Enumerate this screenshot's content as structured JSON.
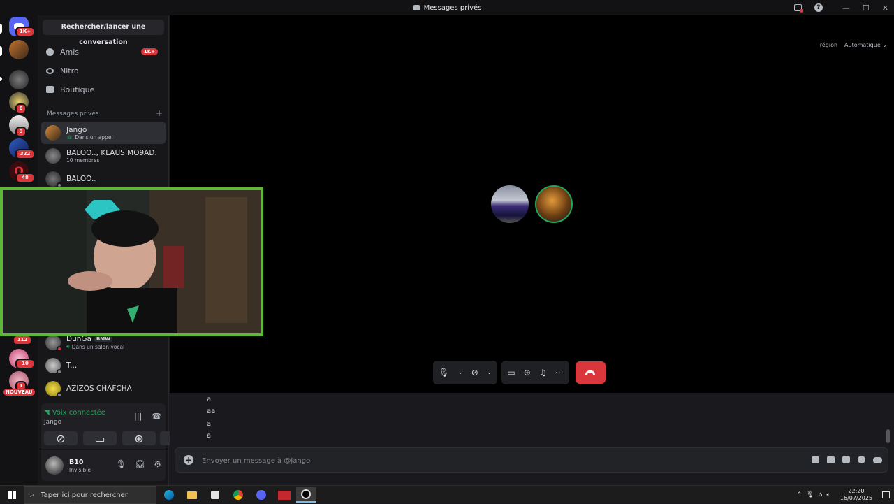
{
  "window": {
    "title": "Messages privés"
  },
  "guilds": {
    "home_badge": "1K+",
    "badges": [
      "6",
      "9",
      "322",
      "48",
      "112",
      "10",
      "1"
    ],
    "new_label": "NOUVEAU"
  },
  "dm_column": {
    "search_label": "Rechercher/lancer une conversation",
    "nav": [
      {
        "label": "Amis",
        "badge": "1K+",
        "icon": "friends-icon"
      },
      {
        "label": "Nitro",
        "icon": "nitro-icon"
      },
      {
        "label": "Boutique",
        "icon": "shop-icon"
      }
    ],
    "section_title": "Messages privés",
    "section_add": "+",
    "dms": [
      {
        "name": "Jango",
        "sub": "Dans un appel"
      },
      {
        "name": "BALOO.., KLAUS MO9AD...",
        "sub": "10 membres"
      },
      {
        "name": "BALOO.."
      },
      {
        "name": "DunGa",
        "tag": "BMW",
        "sub": "Dans un salon vocal"
      },
      {
        "name": "T..."
      },
      {
        "name": "AZIZOS CHAFCHA"
      }
    ]
  },
  "voice": {
    "status": "Voix connectée",
    "channel": "Jango"
  },
  "user": {
    "name": "B10",
    "status": "Invisible"
  },
  "call": {
    "region_label": "région",
    "region_value": "Automatique"
  },
  "chat": {
    "messages": [
      "a",
      "aa",
      "a",
      "a"
    ],
    "placeholder": "Envoyer un message à @Jango"
  },
  "taskbar": {
    "search_placeholder": "Taper ici pour rechercher",
    "time": "22:20",
    "date": "16/07/2025"
  },
  "colors": {
    "accent_red": "#da373c",
    "online_green": "#23a55a",
    "blurple": "#5865f2",
    "overlay_border": "#5cb836"
  }
}
